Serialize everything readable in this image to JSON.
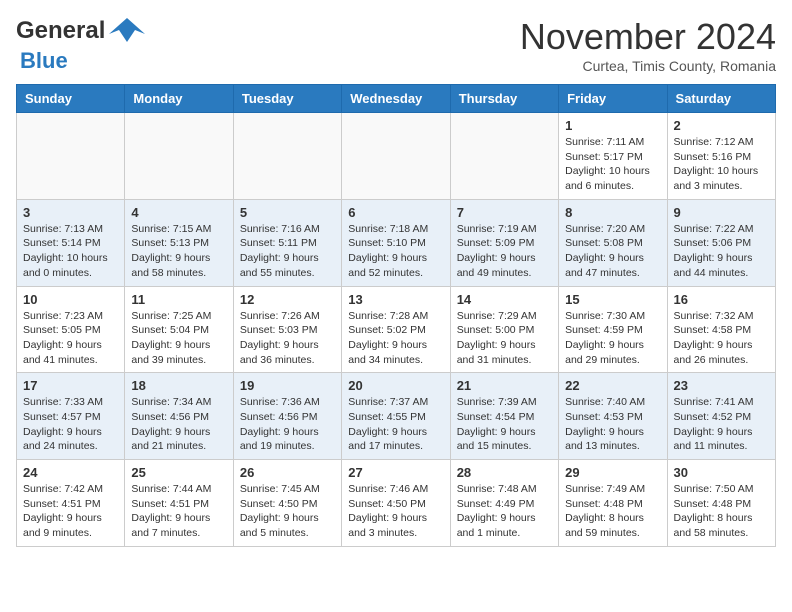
{
  "header": {
    "logo_general": "General",
    "logo_blue": "Blue",
    "month_title": "November 2024",
    "location": "Curtea, Timis County, Romania"
  },
  "days_of_week": [
    "Sunday",
    "Monday",
    "Tuesday",
    "Wednesday",
    "Thursday",
    "Friday",
    "Saturday"
  ],
  "weeks": [
    {
      "days": [
        {
          "num": "",
          "info": ""
        },
        {
          "num": "",
          "info": ""
        },
        {
          "num": "",
          "info": ""
        },
        {
          "num": "",
          "info": ""
        },
        {
          "num": "",
          "info": ""
        },
        {
          "num": "1",
          "info": "Sunrise: 7:11 AM\nSunset: 5:17 PM\nDaylight: 10 hours\nand 6 minutes."
        },
        {
          "num": "2",
          "info": "Sunrise: 7:12 AM\nSunset: 5:16 PM\nDaylight: 10 hours\nand 3 minutes."
        }
      ]
    },
    {
      "days": [
        {
          "num": "3",
          "info": "Sunrise: 7:13 AM\nSunset: 5:14 PM\nDaylight: 10 hours\nand 0 minutes."
        },
        {
          "num": "4",
          "info": "Sunrise: 7:15 AM\nSunset: 5:13 PM\nDaylight: 9 hours\nand 58 minutes."
        },
        {
          "num": "5",
          "info": "Sunrise: 7:16 AM\nSunset: 5:11 PM\nDaylight: 9 hours\nand 55 minutes."
        },
        {
          "num": "6",
          "info": "Sunrise: 7:18 AM\nSunset: 5:10 PM\nDaylight: 9 hours\nand 52 minutes."
        },
        {
          "num": "7",
          "info": "Sunrise: 7:19 AM\nSunset: 5:09 PM\nDaylight: 9 hours\nand 49 minutes."
        },
        {
          "num": "8",
          "info": "Sunrise: 7:20 AM\nSunset: 5:08 PM\nDaylight: 9 hours\nand 47 minutes."
        },
        {
          "num": "9",
          "info": "Sunrise: 7:22 AM\nSunset: 5:06 PM\nDaylight: 9 hours\nand 44 minutes."
        }
      ]
    },
    {
      "days": [
        {
          "num": "10",
          "info": "Sunrise: 7:23 AM\nSunset: 5:05 PM\nDaylight: 9 hours\nand 41 minutes."
        },
        {
          "num": "11",
          "info": "Sunrise: 7:25 AM\nSunset: 5:04 PM\nDaylight: 9 hours\nand 39 minutes."
        },
        {
          "num": "12",
          "info": "Sunrise: 7:26 AM\nSunset: 5:03 PM\nDaylight: 9 hours\nand 36 minutes."
        },
        {
          "num": "13",
          "info": "Sunrise: 7:28 AM\nSunset: 5:02 PM\nDaylight: 9 hours\nand 34 minutes."
        },
        {
          "num": "14",
          "info": "Sunrise: 7:29 AM\nSunset: 5:00 PM\nDaylight: 9 hours\nand 31 minutes."
        },
        {
          "num": "15",
          "info": "Sunrise: 7:30 AM\nSunset: 4:59 PM\nDaylight: 9 hours\nand 29 minutes."
        },
        {
          "num": "16",
          "info": "Sunrise: 7:32 AM\nSunset: 4:58 PM\nDaylight: 9 hours\nand 26 minutes."
        }
      ]
    },
    {
      "days": [
        {
          "num": "17",
          "info": "Sunrise: 7:33 AM\nSunset: 4:57 PM\nDaylight: 9 hours\nand 24 minutes."
        },
        {
          "num": "18",
          "info": "Sunrise: 7:34 AM\nSunset: 4:56 PM\nDaylight: 9 hours\nand 21 minutes."
        },
        {
          "num": "19",
          "info": "Sunrise: 7:36 AM\nSunset: 4:56 PM\nDaylight: 9 hours\nand 19 minutes."
        },
        {
          "num": "20",
          "info": "Sunrise: 7:37 AM\nSunset: 4:55 PM\nDaylight: 9 hours\nand 17 minutes."
        },
        {
          "num": "21",
          "info": "Sunrise: 7:39 AM\nSunset: 4:54 PM\nDaylight: 9 hours\nand 15 minutes."
        },
        {
          "num": "22",
          "info": "Sunrise: 7:40 AM\nSunset: 4:53 PM\nDaylight: 9 hours\nand 13 minutes."
        },
        {
          "num": "23",
          "info": "Sunrise: 7:41 AM\nSunset: 4:52 PM\nDaylight: 9 hours\nand 11 minutes."
        }
      ]
    },
    {
      "days": [
        {
          "num": "24",
          "info": "Sunrise: 7:42 AM\nSunset: 4:51 PM\nDaylight: 9 hours\nand 9 minutes."
        },
        {
          "num": "25",
          "info": "Sunrise: 7:44 AM\nSunset: 4:51 PM\nDaylight: 9 hours\nand 7 minutes."
        },
        {
          "num": "26",
          "info": "Sunrise: 7:45 AM\nSunset: 4:50 PM\nDaylight: 9 hours\nand 5 minutes."
        },
        {
          "num": "27",
          "info": "Sunrise: 7:46 AM\nSunset: 4:50 PM\nDaylight: 9 hours\nand 3 minutes."
        },
        {
          "num": "28",
          "info": "Sunrise: 7:48 AM\nSunset: 4:49 PM\nDaylight: 9 hours\nand 1 minute."
        },
        {
          "num": "29",
          "info": "Sunrise: 7:49 AM\nSunset: 4:48 PM\nDaylight: 8 hours\nand 59 minutes."
        },
        {
          "num": "30",
          "info": "Sunrise: 7:50 AM\nSunset: 4:48 PM\nDaylight: 8 hours\nand 58 minutes."
        }
      ]
    }
  ]
}
